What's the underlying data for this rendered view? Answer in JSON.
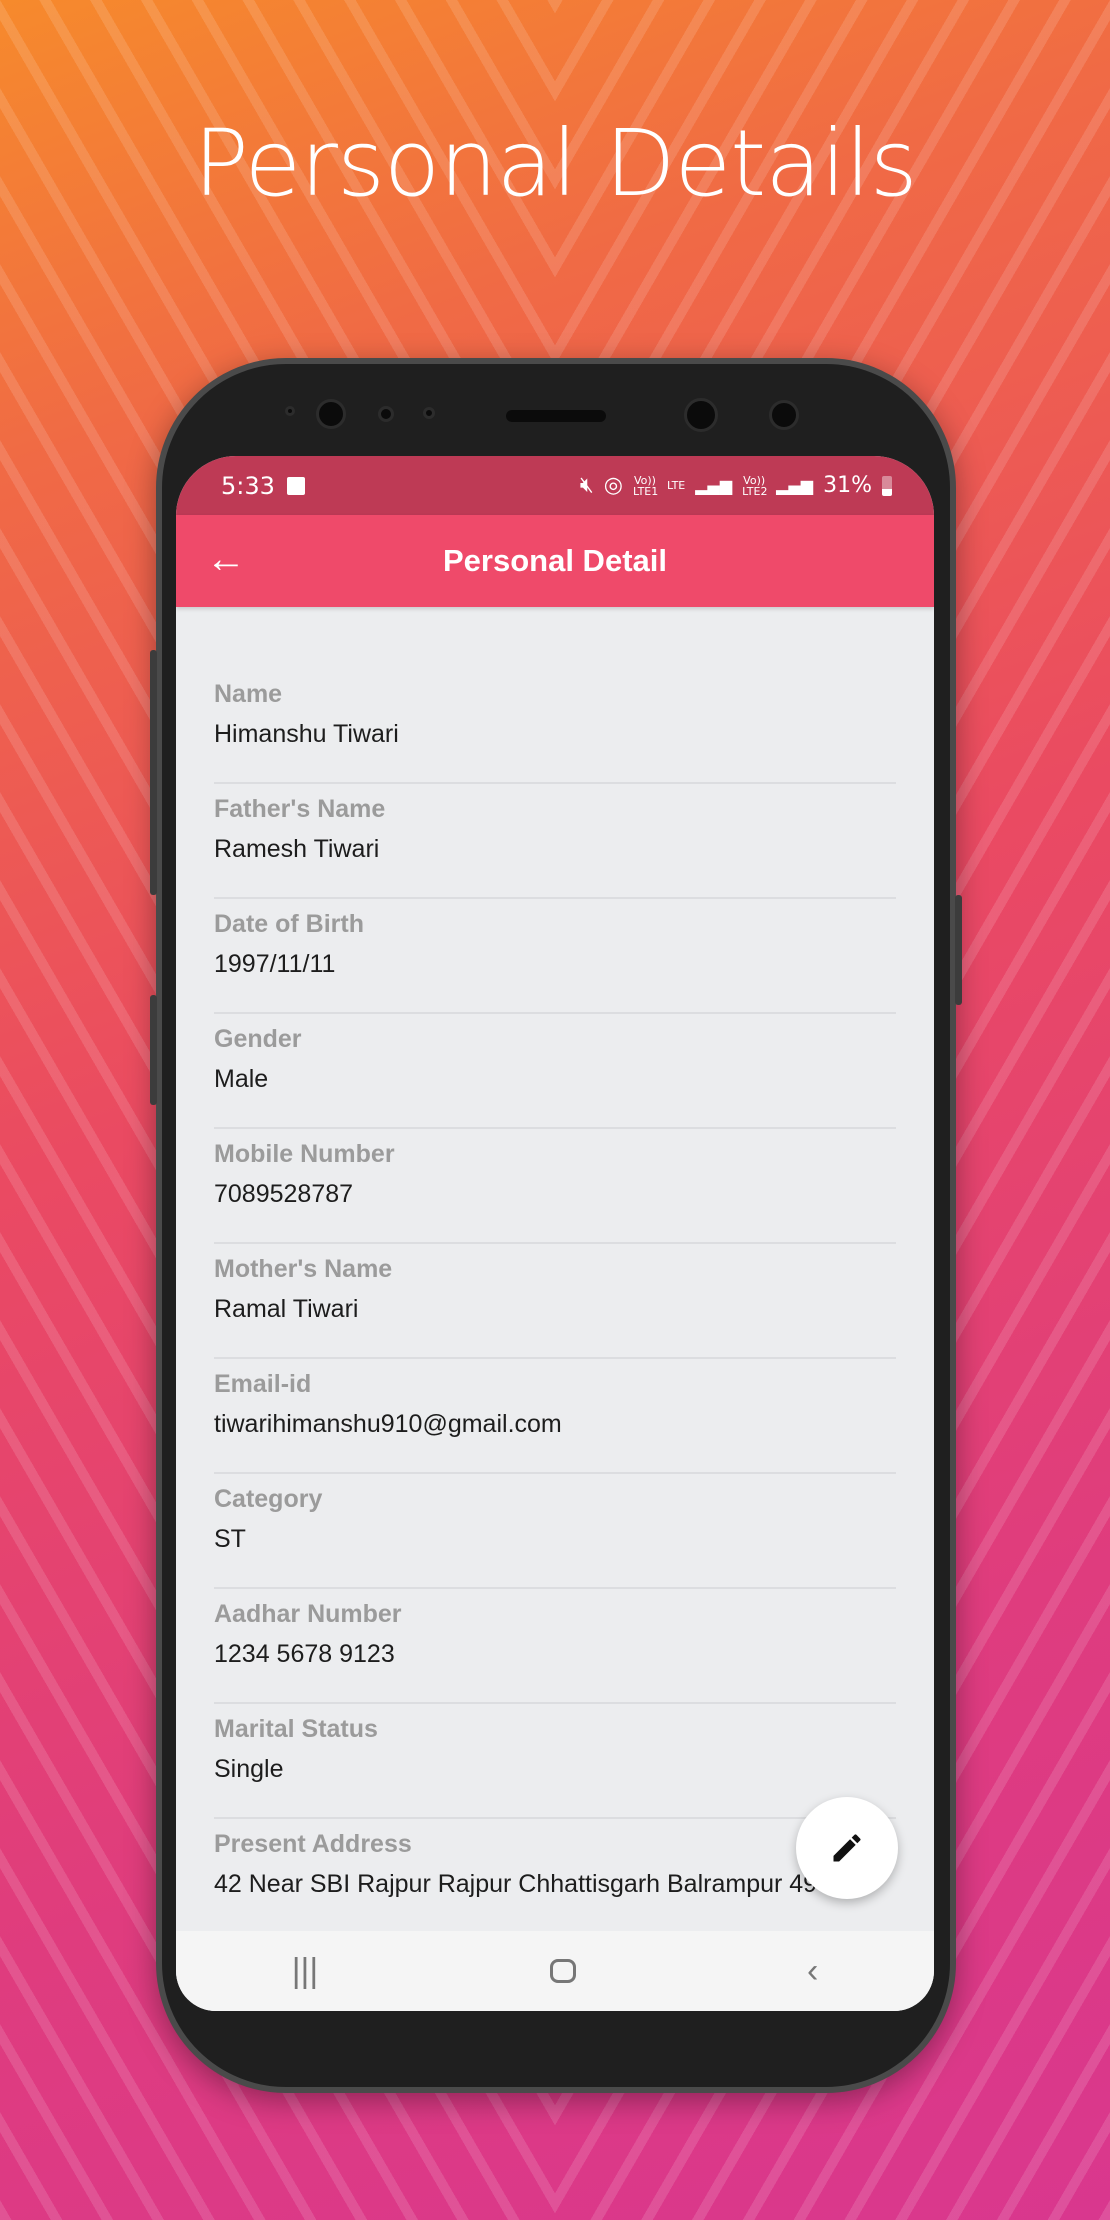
{
  "headline": "Personal Details",
  "status": {
    "time": "5:33",
    "network1": "Vo)) LTE1",
    "network2": "LTE",
    "network3": "Vo)) LTE2",
    "battery": "31%"
  },
  "appbar": {
    "title": "Personal Detail"
  },
  "fields": [
    {
      "label": "Name",
      "value": "Himanshu Tiwari"
    },
    {
      "label": "Father's Name",
      "value": "Ramesh Tiwari"
    },
    {
      "label": "Date of Birth",
      "value": "1997/11/11"
    },
    {
      "label": "Gender",
      "value": "Male"
    },
    {
      "label": "Mobile Number",
      "value": "7089528787"
    },
    {
      "label": "Mother's Name",
      "value": "Ramal Tiwari"
    },
    {
      "label": "Email-id",
      "value": "tiwarihimanshu910@gmail.com"
    },
    {
      "label": "Category",
      "value": "ST"
    },
    {
      "label": "Aadhar Number",
      "value": "1234 5678 9123"
    },
    {
      "label": "Marital Status",
      "value": "Single"
    },
    {
      "label": "Present Address",
      "value": "42 Near SBI Rajpur Rajpur Chhattisgarh Balrampur 497"
    }
  ],
  "colors": {
    "appbar": "#ef4a6a",
    "statusbar": "#be3a55"
  }
}
